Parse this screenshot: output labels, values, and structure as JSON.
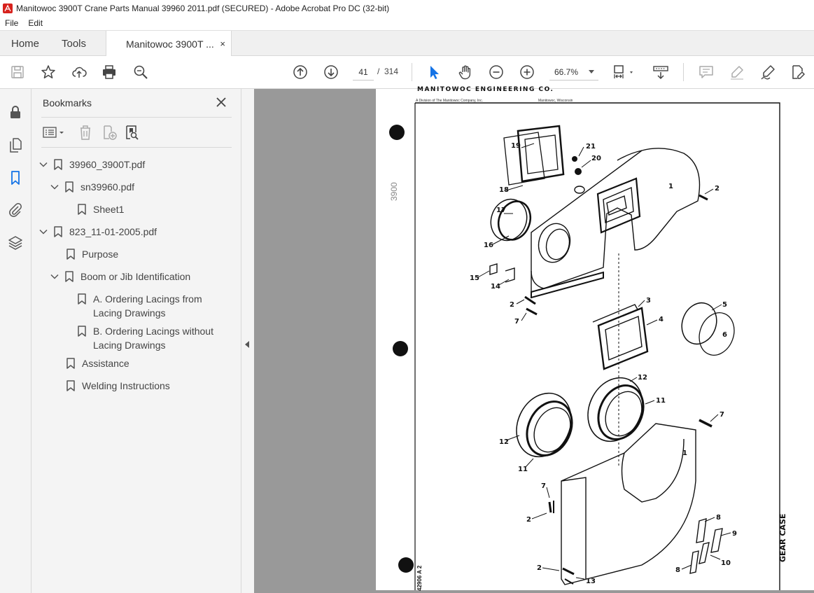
{
  "window": {
    "title": "Manitowoc 3900T Crane Parts Manual 39960 2011.pdf (SECURED) - Adobe Acrobat Pro DC (32-bit)"
  },
  "menu": {
    "file": "File",
    "edit": "Edit"
  },
  "tabs": {
    "home": "Home",
    "tools": "Tools",
    "document": "Manitowoc 3900T ...",
    "close": "×"
  },
  "toolbar": {
    "page_current": "41",
    "page_sep": "/",
    "page_total": "314",
    "zoom": "66.7%"
  },
  "bookmarks": {
    "title": "Bookmarks",
    "items": [
      {
        "label": "39960_3900T.pdf",
        "level": 0,
        "expanded": true
      },
      {
        "label": "sn39960.pdf",
        "level": 1,
        "expanded": true
      },
      {
        "label": "Sheet1",
        "level": 2
      },
      {
        "label": "823_11-01-2005.pdf",
        "level": 0,
        "expanded": true
      },
      {
        "label": "Purpose",
        "level": 1
      },
      {
        "label": "Boom or Jib Identification",
        "level": 1,
        "expanded": true
      },
      {
        "label": "A. Ordering Lacings from Lacing Drawings",
        "level": 2
      },
      {
        "label": "B. Ordering Lacings without Lacing Drawings",
        "level": 2
      },
      {
        "label": "Assistance",
        "level": 1
      },
      {
        "label": "Welding Instructions",
        "level": 1
      }
    ]
  },
  "document_page": {
    "header": "MANITOWOC ENGINEERING CO.",
    "subheader_left": "A Division of The Manitowoc Company, Inc.",
    "subheader_right": "Manitowoc, Wisconsin",
    "side_title": "GEAR CASE",
    "drawing_code": "42906 A 2",
    "part_numbers": [
      "1",
      "2",
      "3",
      "4",
      "5",
      "6",
      "7",
      "8",
      "9",
      "10",
      "11",
      "12",
      "13",
      "14",
      "15",
      "16",
      "17",
      "18",
      "19",
      "20",
      "21"
    ]
  },
  "colors": {
    "accent_blue": "#1473e6",
    "doc_gray": "#999999",
    "panel_bg": "#f4f4f4"
  }
}
